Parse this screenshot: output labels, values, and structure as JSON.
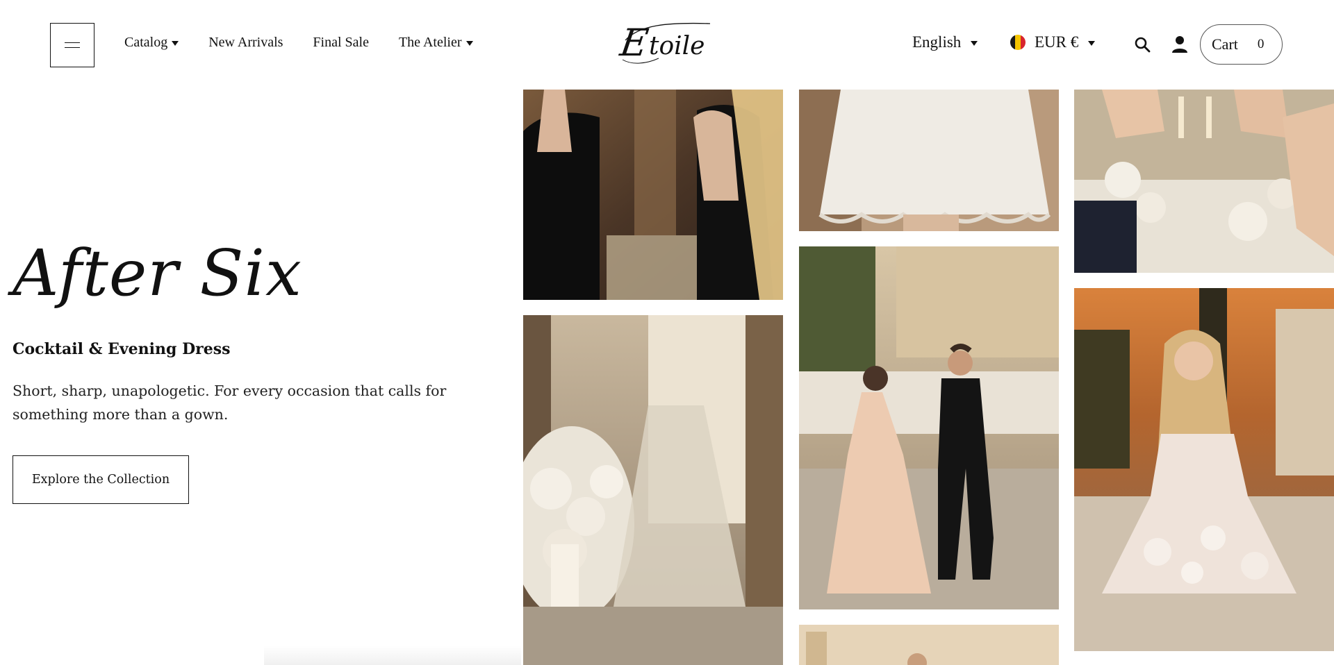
{
  "header": {
    "menu_icon": "hamburger-icon",
    "nav": [
      {
        "label": "Catalog",
        "dropdown": true
      },
      {
        "label": "New Arrivals",
        "dropdown": false
      },
      {
        "label": "Final Sale",
        "dropdown": false
      },
      {
        "label": "The Atelier",
        "dropdown": true
      }
    ],
    "logo_text": "Etoile",
    "language": "English",
    "currency": "EUR €",
    "currency_flag": "belgium-flag",
    "search_icon": "search-icon",
    "account_icon": "user-icon",
    "cart_label": "Cart",
    "cart_count": "0"
  },
  "hero": {
    "title": "After Six",
    "subtitle": "Cocktail & Evening Dress",
    "description": "Short, sharp, unapologetic. For every occasion that calls for something more than a gown.",
    "cta_label": "Explore the Collection"
  },
  "gallery": [
    {
      "name": "photo-black-sequin-dresses"
    },
    {
      "name": "photo-champagne-tower"
    },
    {
      "name": "photo-white-lace-skirt"
    },
    {
      "name": "photo-couple-walking"
    },
    {
      "name": "photo-bottom-partial"
    },
    {
      "name": "photo-toast-glasses"
    },
    {
      "name": "photo-floral-cocktail-dress"
    }
  ],
  "colors": {
    "text": "#111111",
    "background": "#ffffff",
    "flag_black": "#1a1a1a",
    "flag_yellow": "#f5c400",
    "flag_red": "#d8252e"
  }
}
